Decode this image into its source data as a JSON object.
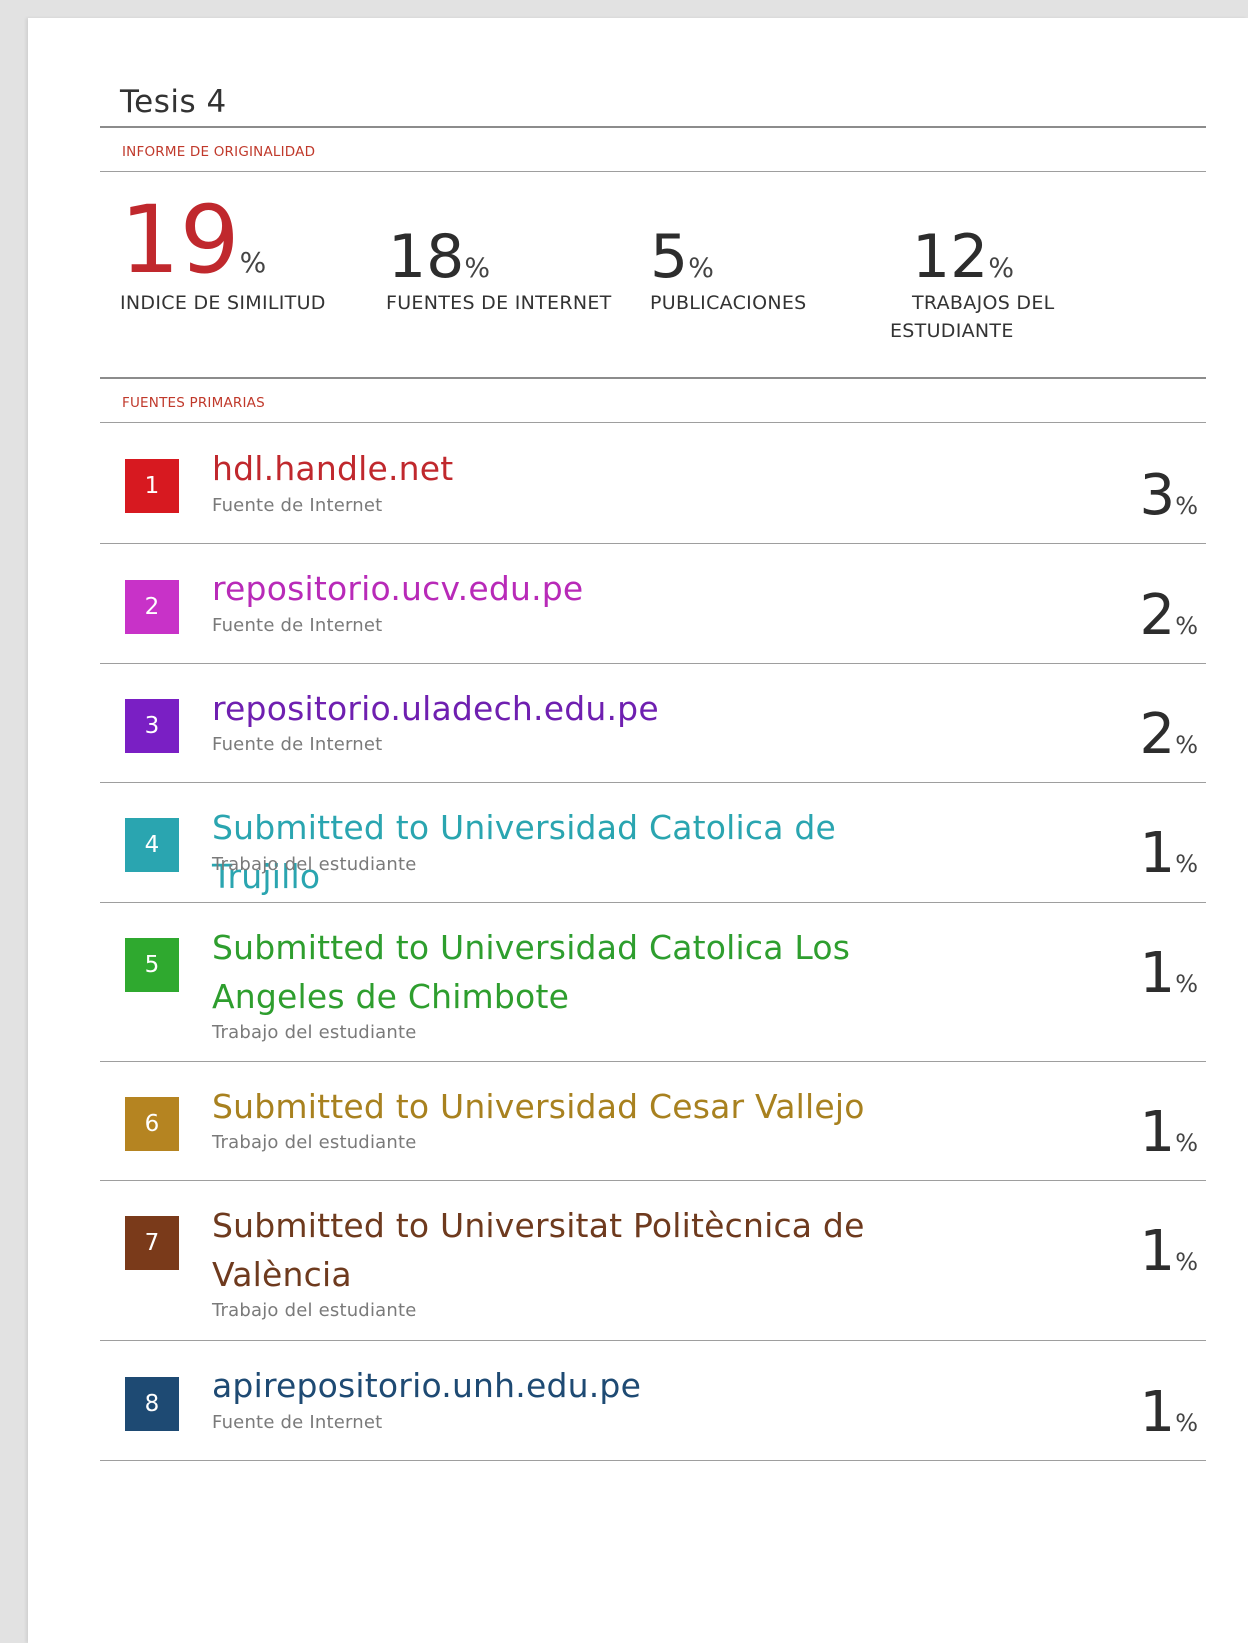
{
  "report": {
    "title": "Tesis 4",
    "originality_heading": "INFORME DE ORIGINALIDAD",
    "primary_sources_heading": "FUENTES PRIMARIAS",
    "percent_sign": "%",
    "stats": [
      {
        "value": "19",
        "label": "INDICE DE SIMILITUD",
        "color": "#c0282d"
      },
      {
        "value": "18",
        "label": "FUENTES DE INTERNET",
        "color": "#2d2d2d"
      },
      {
        "value": "5",
        "label": "PUBLICACIONES",
        "color": "#2d2d2d"
      },
      {
        "value": "12",
        "label_line1": "TRABAJOS DEL",
        "label_line2": "ESTUDIANTE",
        "color": "#2d2d2d"
      }
    ],
    "sources": [
      {
        "rank": "1",
        "name": "hdl.handle.net",
        "type": "Fuente de Internet",
        "percent": "3",
        "color": "#d71920"
      },
      {
        "rank": "2",
        "name": "repositorio.ucv.edu.pe",
        "type": "Fuente de Internet",
        "percent": "2",
        "color": "#c832c8"
      },
      {
        "rank": "3",
        "name": "repositorio.uladech.edu.pe",
        "type": "Fuente de Internet",
        "percent": "2",
        "color": "#7a1fc4"
      },
      {
        "rank": "4",
        "name": "Submitted to Universidad Catolica de Trujillo",
        "type": "Trabajo del estudiante",
        "percent": "1",
        "color": "#2aa5b0"
      },
      {
        "rank": "5",
        "name": "Submitted to Universidad Catolica Los Angeles de Chimbote",
        "type": "Trabajo del estudiante",
        "percent": "1",
        "color": "#2fa92f"
      },
      {
        "rank": "6",
        "name": "Submitted to Universidad Cesar Vallejo",
        "type": "Trabajo del estudiante",
        "percent": "1",
        "color": "#b58421"
      },
      {
        "rank": "7",
        "name": "Submitted to Universitat Politècnica de València",
        "type": "Trabajo del estudiante",
        "percent": "1",
        "color": "#7a3a1a"
      },
      {
        "rank": "8",
        "name": "apirepositorio.unh.edu.pe",
        "type": "Fuente de Internet",
        "percent": "1",
        "color": "#1e4a73"
      }
    ]
  }
}
